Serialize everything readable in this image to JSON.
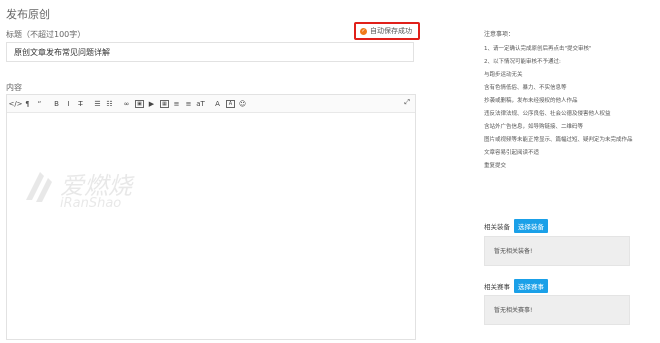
{
  "page": {
    "title": "发布原创"
  },
  "title_field": {
    "label": "标题（不超过100字）",
    "value": "原创文章发布常见问题详解"
  },
  "autosave": {
    "label": "自动保存成功"
  },
  "content_field": {
    "label": "内容"
  },
  "toolbar": {
    "buttons": [
      {
        "name": "code-icon",
        "glyph": "</>"
      },
      {
        "name": "paragraph-icon",
        "glyph": "¶"
      },
      {
        "name": "quote-icon",
        "glyph": "“"
      },
      {
        "name": "bold-icon",
        "glyph": "B"
      },
      {
        "name": "italic-icon",
        "glyph": "I"
      },
      {
        "name": "strikethrough-icon",
        "glyph": "T̶"
      },
      {
        "name": "unordered-list-icon",
        "glyph": "☰"
      },
      {
        "name": "ordered-list-icon",
        "glyph": "☷"
      },
      {
        "name": "link-icon",
        "glyph": "∞"
      },
      {
        "name": "image-icon",
        "glyph": "▣"
      },
      {
        "name": "video-icon",
        "glyph": "▶"
      },
      {
        "name": "table-icon",
        "glyph": "▦"
      },
      {
        "name": "align-left-icon",
        "glyph": "≡"
      },
      {
        "name": "align-center-icon",
        "glyph": "≡"
      },
      {
        "name": "font-size-icon",
        "glyph": "aT"
      },
      {
        "name": "font-color-icon",
        "glyph": "A"
      },
      {
        "name": "background-color-icon",
        "glyph": "A"
      },
      {
        "name": "emoji-icon",
        "glyph": "☺"
      }
    ],
    "fullscreen_glyph": "⤢"
  },
  "watermark": {
    "cn": "爱燃烧",
    "en": "iRanShao"
  },
  "notes": {
    "title": "注意事项：",
    "items": [
      "1、请一定确认完成原创后再点击\"提交审核\"",
      "2、以下情况可能审核不予通过:",
      "与跑步运动无关",
      "含有色情低俗、暴力、不实信息等",
      "抄袭或删稿，发布未经授权的他人作品",
      "违反法律法规、公序良俗、社会公德及侵害他人权益",
      "含站外广告信息，如导购链接、二维码等",
      "图片或视频等未能正常显示、篇幅过短、疑判定为未完成作品",
      "文章容易引起阅读不适",
      "重复提交"
    ]
  },
  "related_gear": {
    "label": "相关装备",
    "button": "选择装备",
    "empty": "暂无相关装备!"
  },
  "related_events": {
    "label": "相关赛事",
    "button": "选择赛事",
    "empty": "暂无相关赛事!"
  },
  "colors": {
    "accent": "#1aa0e8",
    "highlight": "#e0201a",
    "autosave_dot": "#f07a1a"
  }
}
